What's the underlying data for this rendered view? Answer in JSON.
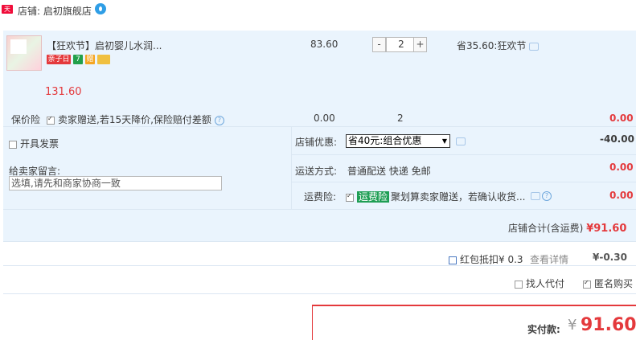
{
  "shop": {
    "badge": "天猫",
    "label": "店铺: 启初旗舰店"
  },
  "item": {
    "name": "【狂欢节】启初婴儿水润...",
    "tags": [
      "亲子日",
      "7",
      "赠",
      ""
    ],
    "price": "83.60",
    "qty": "2",
    "qty_minus": "-",
    "qty_plus": "+",
    "discount": "省35.60:狂欢节",
    "subtotal": "131.60"
  },
  "insurance": {
    "label": "保价险",
    "desc": "卖家赠送,若15天降价,保险赔付差额",
    "price": "0.00",
    "qty": "2",
    "total": "0.00"
  },
  "invoice": {
    "label": "开具发票"
  },
  "coupon": {
    "label": "店铺优惠:",
    "selected": "省40元:组合优惠",
    "amount": "-40.00"
  },
  "message": {
    "label": "给卖家留言:",
    "placeholder": "选填,请先和商家协商一致"
  },
  "shipping": {
    "label": "运送方式:",
    "value": "普通配送 快递 免邮",
    "amount": "0.00"
  },
  "freight": {
    "label": "运费险:",
    "tag": "运费险",
    "desc": "聚划算卖家赠送，若确认收货...",
    "amount": "0.00"
  },
  "store_total": {
    "label": "店铺合计(含运费)",
    "amount": "¥91.60"
  },
  "redpacket": {
    "label": "红包抵扣¥ 0.3",
    "link": "查看详情",
    "amount": "¥-0.30"
  },
  "options": {
    "proxy": "找人代付",
    "anon": "匿名购买"
  },
  "final": {
    "label": "实付款:",
    "currency": "¥",
    "amount": "91.60"
  },
  "colors": {
    "accent": "#e4393c",
    "panel": "#eaf4fd",
    "tag_green": "#1e9e54"
  }
}
